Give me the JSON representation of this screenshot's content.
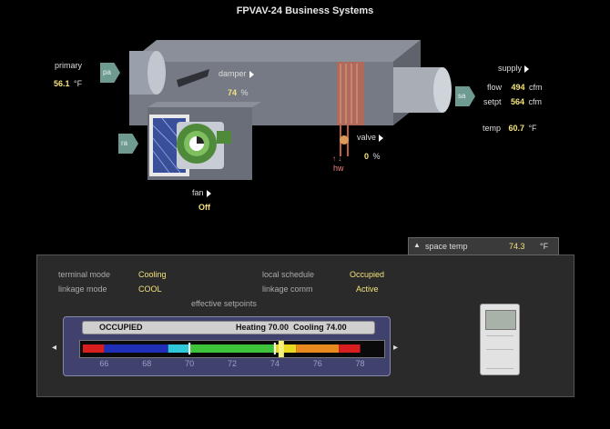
{
  "title": "FPVAV-24 Business Systems",
  "primary": {
    "label": "primary",
    "value": "56.1",
    "unit": "°F",
    "tag": "pa"
  },
  "return_tag": "ra",
  "supply_tag": "sa",
  "damper": {
    "label": "damper",
    "value": "74",
    "unit": "%"
  },
  "valve": {
    "label": "valve",
    "value": "0",
    "unit": "%",
    "hw": "hw"
  },
  "fan": {
    "label": "fan",
    "value": "Off"
  },
  "supply": {
    "label": "supply",
    "flow_label": "flow",
    "flow_value": "494",
    "flow_unit": "cfm",
    "setpt_label": "setpt",
    "setpt_value": "564",
    "setpt_unit": "cfm",
    "temp_label": "temp",
    "temp_value": "60.7",
    "temp_unit": "°F"
  },
  "space_temp": {
    "label": "space temp",
    "value": "74.3",
    "unit": "°F"
  },
  "status": {
    "terminal_mode_label": "terminal mode",
    "terminal_mode": "Cooling",
    "linkage_mode_label": "linkage mode",
    "linkage_mode": "COOL",
    "local_schedule_label": "local schedule",
    "local_schedule": "Occupied",
    "linkage_comm_label": "linkage comm",
    "linkage_comm": "Active",
    "effective_setpoints_label": "effective setpoints"
  },
  "setpoints": {
    "occupancy": "OCCUPIED",
    "heating_label": "Heating",
    "heating_value": "70.00",
    "cooling_label": "Cooling",
    "cooling_value": "74.00",
    "scale_min": 65,
    "scale_max": 79,
    "current": 74.3,
    "ticks": [
      "66",
      "68",
      "70",
      "72",
      "74",
      "76",
      "78"
    ]
  },
  "colors": {
    "label_value": "#f4e27a",
    "tag": "#6f9a92",
    "schedule_box": "#41416d"
  }
}
